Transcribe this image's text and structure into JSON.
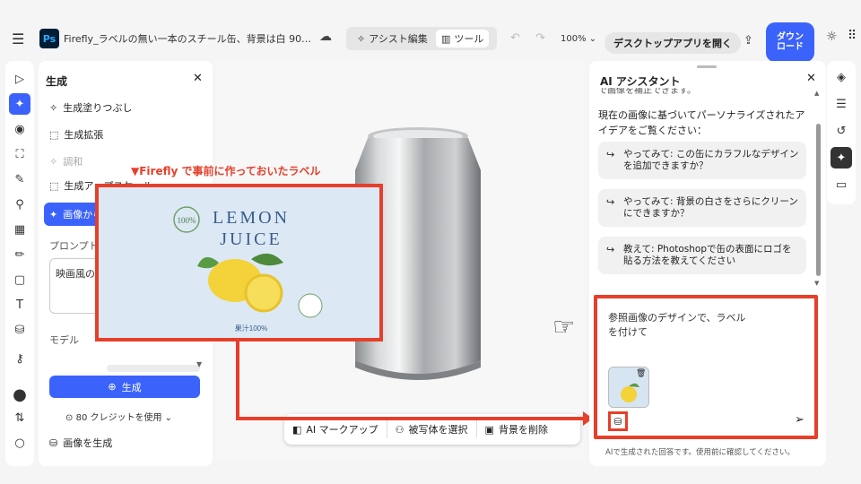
{
  "header": {
    "menu_icon": "menu-icon",
    "app_logo": "Ps",
    "doc_title": "Firefly_ラベルの無い一本のスチール缶、背景は白 90…",
    "cloud_icon": "☁",
    "assist_label": "アシスト編集",
    "tools_label": "ツール",
    "zoom": "100%",
    "open_desktop": "デスクトップアプリを開く",
    "download": "ダウンロード",
    "bulb_icon": "☼",
    "apps_icon": "⠿"
  },
  "toolrail": [
    "▷",
    "✦",
    "◉",
    "⛶",
    "✎",
    "⚲",
    "▦",
    "✏",
    "▢",
    "T",
    "⛁",
    "⚷",
    "●",
    "⇅",
    "○"
  ],
  "gen_panel": {
    "title": "生成",
    "close": "✕",
    "items": [
      {
        "label": "生成塗りつぶし",
        "icon": "✧"
      },
      {
        "label": "生成拡張",
        "icon": "⬚"
      },
      {
        "label": "調和",
        "icon": "✧"
      },
      {
        "label": "生成アップスケール",
        "icon": "⬚"
      },
      {
        "label": "画像から生成",
        "icon": "✦"
      }
    ],
    "prompt_label": "プロンプト",
    "prompt_value": "映画風の",
    "model_label": "モデル",
    "generate_button": "生成",
    "credit_text": "80 クレジットを使用",
    "generate_image": "画像を生成"
  },
  "canvas": {
    "ref_label": "▼Firefly で事前に作っておいたラベル",
    "label_brand": "LEMON",
    "label_product": "JUICE",
    "label_badge": "100%",
    "label_footer": "果汁100%",
    "taskbar": [
      {
        "label": "AI マークアップ",
        "icon": "◧"
      },
      {
        "label": "被写体を選択",
        "icon": "⚇"
      },
      {
        "label": "背景を削除",
        "icon": "▣"
      }
    ]
  },
  "ai_panel": {
    "title": "AI アシスタント",
    "close": "✕",
    "clipped": "で画像を補正できます。",
    "intro": "現在の画像に基づいてパーソナライズされたアイデアをご覧ください：",
    "suggestions": [
      "やってみて: この缶にカラフルなデザインを追加できますか？",
      "やってみて: 背景の白さをさらにクリーンにできますか？",
      "教えて: Photoshopで缶の表面にロゴを貼る方法を教えてください"
    ],
    "input_text": "参照画像のデザインで、ラベルを付けて",
    "footer": "AIで生成された回答です。使用前に確認してください。"
  },
  "right_rail": [
    "◈",
    "☰",
    "↺",
    "✦",
    "▭"
  ],
  "colors": {
    "accent": "#3b63fb",
    "annotation": "#e63f2a"
  }
}
